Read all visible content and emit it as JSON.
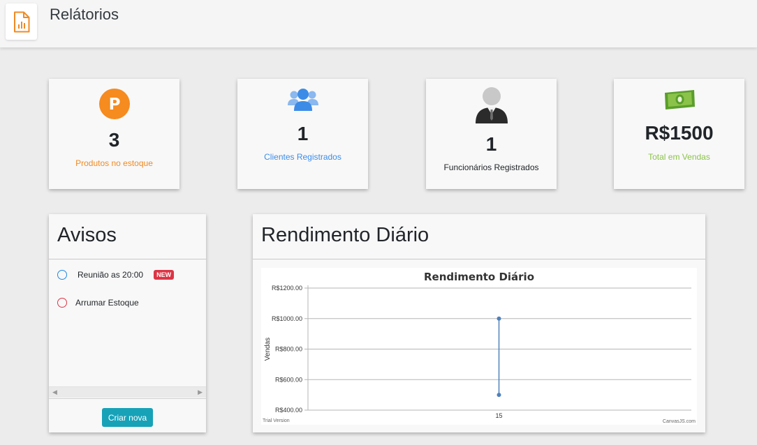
{
  "page": {
    "title": "Relátorios",
    "icon": "report-document-icon"
  },
  "stats": [
    {
      "value": "3",
      "label": "Produtos no estoque",
      "icon": "parking-p-icon",
      "color": "#f08a24"
    },
    {
      "value": "1",
      "label": "Clientes Registrados",
      "icon": "users-group-icon",
      "color": "#3c8ce7"
    },
    {
      "value": "1",
      "label": "Funcionários Registrados",
      "icon": "employee-person-icon",
      "color": "#212529"
    },
    {
      "value": "R$1500",
      "label": "Total em Vendas",
      "icon": "money-bill-icon",
      "color": "#8bc34a"
    }
  ],
  "avisos": {
    "title": "Avisos",
    "items": [
      {
        "text": "Reunião as 20:00",
        "badge": "NEW",
        "color": "#1e88e5"
      },
      {
        "text": "Arrumar Estoque",
        "color": "#dc3545"
      }
    ],
    "button": "Criar nova"
  },
  "rendimento": {
    "title": "Rendimento Diário"
  },
  "chart_data": {
    "type": "line",
    "title": "Rendimento Diário",
    "ylabel": "Vendas",
    "xlabel": "",
    "categories": [
      "15"
    ],
    "series": [
      {
        "x": [
          15,
          15
        ],
        "values": [
          1000,
          500
        ],
        "color": "#4f81bc"
      }
    ],
    "yticks": [
      "R$1200.00",
      "R$1000.00",
      "R$800.00",
      "R$600.00",
      "R$400.00"
    ],
    "ylim": [
      400,
      1200
    ],
    "grid": true,
    "watermark_left": "Trial Version",
    "watermark_right": "CanvasJS.com"
  }
}
